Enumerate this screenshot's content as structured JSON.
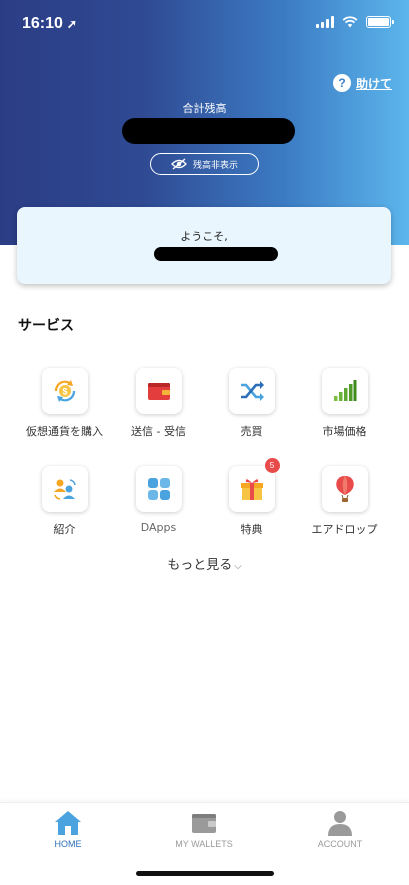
{
  "status_bar": {
    "time": "16:10"
  },
  "header": {
    "help_label": "助けて",
    "help_icon_text": "?",
    "balance_title": "合計残高",
    "hide_balance_label": "残高非表示"
  },
  "welcome": {
    "text": "ようこそ,"
  },
  "services": {
    "title": "サービス",
    "items": [
      {
        "label": "仮想通貨を購入",
        "icon": "buy-crypto-icon"
      },
      {
        "label": "送信 - 受信",
        "icon": "wallet-icon"
      },
      {
        "label": "売買",
        "icon": "shuffle-icon"
      },
      {
        "label": "市場価格",
        "icon": "signal-bars-icon"
      },
      {
        "label": "紹介",
        "icon": "referral-icon"
      },
      {
        "label": "DApps",
        "icon": "apps-grid-icon"
      },
      {
        "label": "特典",
        "icon": "gift-icon",
        "badge": "5"
      },
      {
        "label": "エアドロップ",
        "icon": "balloon-icon"
      }
    ],
    "more_label": "もっと見る"
  },
  "tabbar": {
    "tabs": [
      {
        "label": "HOME",
        "active": true
      },
      {
        "label": "MY WALLETS",
        "active": false
      },
      {
        "label": "ACCOUNT",
        "active": false
      }
    ]
  },
  "colors": {
    "header_gradient_start": "#2b3d85",
    "header_gradient_end": "#5cb6ec",
    "active_tab": "#4aa3df",
    "inactive_tab": "#9a9a9a",
    "badge": "#e94a4a"
  }
}
